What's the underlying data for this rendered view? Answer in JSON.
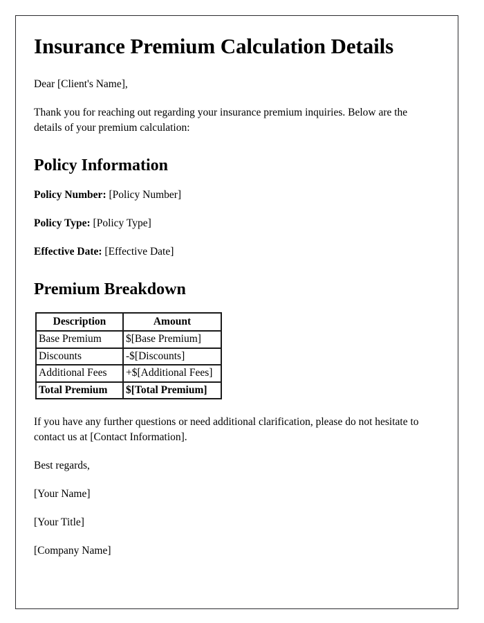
{
  "document": {
    "title": "Insurance Premium Calculation Details",
    "salutation": "Dear [Client's Name],",
    "intro": "Thank you for reaching out regarding your insurance premium inquiries. Below are the details of your premium calculation:"
  },
  "policy_information": {
    "heading": "Policy Information",
    "fields": [
      {
        "label": "Policy Number:",
        "value": "[Policy Number]"
      },
      {
        "label": "Policy Type:",
        "value": "[Policy Type]"
      },
      {
        "label": "Effective Date:",
        "value": "[Effective Date]"
      }
    ]
  },
  "premium_breakdown": {
    "heading": "Premium Breakdown",
    "columns": [
      "Description",
      "Amount"
    ],
    "rows": [
      {
        "description": "Base Premium",
        "amount": "$[Base Premium]"
      },
      {
        "description": "Discounts",
        "amount": "-$[Discounts]"
      },
      {
        "description": "Additional Fees",
        "amount": "+$[Additional Fees]"
      },
      {
        "description": "Total Premium",
        "amount": "$[Total Premium]"
      }
    ]
  },
  "closing": {
    "contact_paragraph": "If you have any further questions or need additional clarification, please do not hesitate to contact us at [Contact Information].",
    "regards": "Best regards,",
    "signature_name": "[Your Name]",
    "signature_title": "[Your Title]",
    "signature_company": "[Company Name]"
  },
  "colors": {
    "frame_border": "#2b2b2e",
    "table_border": "#1a1a1a",
    "text": "#000000",
    "background": "#ffffff"
  }
}
